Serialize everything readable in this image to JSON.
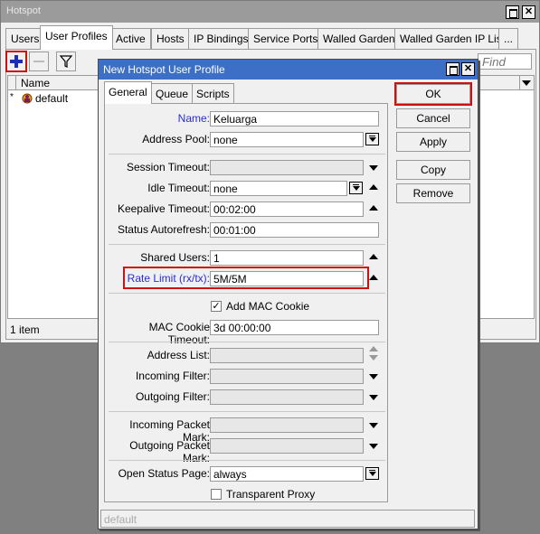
{
  "window": {
    "title": "Hotspot",
    "tabs": [
      "Users",
      "User Profiles",
      "Active",
      "Hosts",
      "IP Bindings",
      "Service Ports",
      "Walled Garden",
      "Walled Garden IP List",
      "..."
    ],
    "find_placeholder": "Find",
    "column_name": "Name",
    "row_marker": "*",
    "rows": [
      "default"
    ],
    "status": "1 item"
  },
  "dialog": {
    "title": "New Hotspot User Profile",
    "tabs": [
      "General",
      "Queue",
      "Scripts"
    ],
    "buttons": [
      "OK",
      "Cancel",
      "Apply",
      "Copy",
      "Remove"
    ],
    "fields": {
      "name_label": "Name:",
      "name_value": "Keluarga",
      "pool_label": "Address Pool:",
      "pool_value": "none",
      "session_label": "Session Timeout:",
      "session_value": "",
      "idle_label": "Idle Timeout:",
      "idle_value": "none",
      "keepalive_label": "Keepalive Timeout:",
      "keepalive_value": "00:02:00",
      "autorefresh_label": "Status Autorefresh:",
      "autorefresh_value": "00:01:00",
      "shared_label": "Shared Users:",
      "shared_value": "1",
      "rate_label": "Rate Limit (rx/tx):",
      "rate_value": "5M/5M",
      "mac_cookie_label": "Add MAC Cookie",
      "mac_cookie_checked": true,
      "mac_timeout_label": "MAC Cookie Timeout:",
      "mac_timeout_value": "3d 00:00:00",
      "address_list_label": "Address List:",
      "in_filter_label": "Incoming Filter:",
      "out_filter_label": "Outgoing Filter:",
      "in_mark_label": "Incoming Packet Mark:",
      "out_mark_label": "Outgoing Packet Mark:",
      "status_page_label": "Open Status Page:",
      "status_page_value": "always",
      "transparent_label": "Transparent Proxy",
      "transparent_checked": false
    },
    "status": "default"
  },
  "colors": {
    "title_bar": "#3c6fc5",
    "highlight": "#d01010",
    "label_blue": "#2b2bd8",
    "add_icon": "#1a2fb5"
  }
}
